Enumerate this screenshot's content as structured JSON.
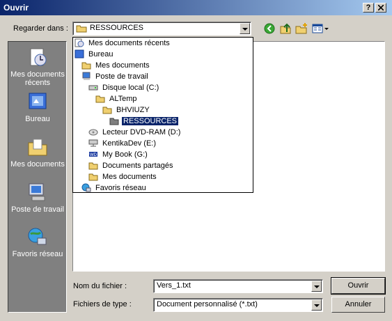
{
  "window": {
    "title": "Ouvrir",
    "help_button": "?",
    "close_button": "X"
  },
  "lookin": {
    "label": "Regarder dans :",
    "value": "RESSOURCES"
  },
  "places": [
    {
      "label": "Mes documents récents",
      "icon": "recent-documents-icon"
    },
    {
      "label": "Bureau",
      "icon": "desktop-icon"
    },
    {
      "label": "Mes documents",
      "icon": "my-documents-icon"
    },
    {
      "label": "Poste de travail",
      "icon": "my-computer-icon"
    },
    {
      "label": "Favoris réseau",
      "icon": "network-places-icon"
    }
  ],
  "dropdown": [
    {
      "label": "Mes documents récents",
      "icon": "recent-documents-icon",
      "level": 0
    },
    {
      "label": "Bureau",
      "icon": "desktop-icon",
      "level": 0
    },
    {
      "label": "Mes documents",
      "icon": "folder-icon",
      "level": 1
    },
    {
      "label": "Poste de travail",
      "icon": "my-computer-icon",
      "level": 1
    },
    {
      "label": "Disque local (C:)",
      "icon": "hard-drive-icon",
      "level": 2
    },
    {
      "label": "ALTemp",
      "icon": "folder-icon",
      "level": 3
    },
    {
      "label": "BHVIUZY",
      "icon": "folder-icon",
      "level": 4
    },
    {
      "label": "RESSOURCES",
      "icon": "folder-open-icon",
      "level": 5,
      "selected": true
    },
    {
      "label": "Lecteur DVD-RAM (D:)",
      "icon": "dvd-drive-icon",
      "level": 2
    },
    {
      "label": "KentikaDev (E:)",
      "icon": "network-drive-icon",
      "level": 2
    },
    {
      "label": "My Book (G:)",
      "icon": "external-drive-icon",
      "level": 2
    },
    {
      "label": "Documents partagés",
      "icon": "folder-icon",
      "level": 2
    },
    {
      "label": "Mes documents",
      "icon": "folder-icon",
      "level": 2
    },
    {
      "label": "Favoris réseau",
      "icon": "network-places-icon",
      "level": 1
    }
  ],
  "filename": {
    "label": "Nom du fichier :",
    "value": "Vers_1.txt"
  },
  "filetype": {
    "label": "Fichiers de type :",
    "value": "Document personnalisé (*.txt)"
  },
  "buttons": {
    "open": "Ouvrir",
    "cancel": "Annuler"
  },
  "colors": {
    "titlebar_start": "#0a246a",
    "titlebar_end": "#a6caf0",
    "selection": "#0a246a",
    "face": "#d4d0c8"
  }
}
